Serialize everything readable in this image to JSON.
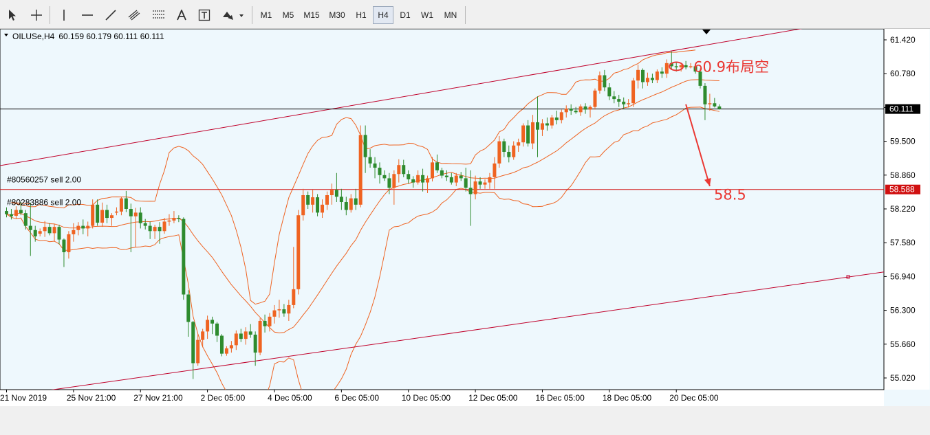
{
  "toolbar": {
    "tools": [
      {
        "name": "cursor-icon"
      },
      {
        "name": "crosshair-icon"
      },
      {
        "name": "vertical-line-icon"
      },
      {
        "name": "horizontal-line-icon"
      },
      {
        "name": "trendline-icon"
      },
      {
        "name": "equidistant-channel-icon"
      },
      {
        "name": "fibonacci-icon"
      },
      {
        "name": "text-icon"
      },
      {
        "name": "text-label-icon"
      },
      {
        "name": "arrows-icon"
      }
    ],
    "timeframes": [
      "M1",
      "M5",
      "M15",
      "M30",
      "H1",
      "H4",
      "D1",
      "W1",
      "MN"
    ],
    "active_timeframe": "H4"
  },
  "chart_header": {
    "symbol": "OILUSe,H4",
    "ohlc": "60.159 60.179 60.111 60.111"
  },
  "colors": {
    "background": "#eef8fd",
    "bull": "#ef6321",
    "bear": "#2e8b2e",
    "bands": "#ef6321",
    "channel": "#c0002a",
    "annotation": "#ea3833",
    "bid_line": "#000000",
    "order_line": "#d01010"
  },
  "chart_data": {
    "type": "candlestick",
    "y_axis_ticks": [
      61.42,
      60.78,
      60.14,
      59.5,
      58.86,
      58.22,
      57.58,
      56.94,
      56.3,
      55.66,
      55.02
    ],
    "y_axis_labels": [
      "61.420",
      "60.780",
      "60.140",
      "59.500",
      "58.860",
      "58.220",
      "57.580",
      "56.940",
      "56.300",
      "55.660",
      "55.020"
    ],
    "x_axis_labels": [
      "21 Nov 2019",
      "25 Nov 21:00",
      "27 Nov 21:00",
      "2 Dec 05:00",
      "4 Dec 05:00",
      "6 Dec 05:00",
      "10 Dec 05:00",
      "12 Dec 05:00",
      "16 Dec 05:00",
      "18 Dec 05:00",
      "20 Dec 05:00"
    ],
    "x_axis_label_bars": [
      0,
      14,
      28,
      42,
      56,
      70,
      84,
      98,
      112,
      126,
      140
    ],
    "current_price": 60.111,
    "current_price_label": "60.111",
    "order_line_price": 58.588,
    "order_line_label": "58.588",
    "orders": [
      "#80560257 sell 2.00",
      "#80283886 sell 2.00"
    ],
    "annotations": [
      {
        "text": "60.9布局空",
        "price": 60.92,
        "bar": 140
      },
      {
        "text": "58.5",
        "price": 58.5,
        "bar": 145
      }
    ],
    "projected_move": {
      "from_bar": 142,
      "from_price": 60.2,
      "to_bar": 147,
      "to_price": 58.65
    },
    "channel_upper": [
      {
        "bar": 0,
        "price": 59.06
      },
      {
        "bar": 157,
        "price": 61.49
      }
    ],
    "channel_lower": [
      {
        "bar": 20,
        "price": 54.93
      },
      {
        "bar": 186,
        "price": 57.06
      }
    ],
    "bars": [
      {
        "o": 58.18,
        "h": 58.25,
        "l": 58.06,
        "c": 58.12
      },
      {
        "o": 58.12,
        "h": 58.22,
        "l": 58.02,
        "c": 58.08
      },
      {
        "o": 58.09,
        "h": 58.27,
        "l": 58.03,
        "c": 58.2
      },
      {
        "o": 58.2,
        "h": 58.35,
        "l": 58.1,
        "c": 58.14
      },
      {
        "o": 58.14,
        "h": 58.2,
        "l": 57.83,
        "c": 57.9
      },
      {
        "o": 57.9,
        "h": 58.34,
        "l": 57.33,
        "c": 57.82
      },
      {
        "o": 57.82,
        "h": 57.9,
        "l": 57.6,
        "c": 57.7
      },
      {
        "o": 57.75,
        "h": 57.85,
        "l": 57.7,
        "c": 57.8
      },
      {
        "o": 57.8,
        "h": 57.99,
        "l": 57.69,
        "c": 57.88
      },
      {
        "o": 57.88,
        "h": 57.95,
        "l": 57.72,
        "c": 57.76
      },
      {
        "o": 57.76,
        "h": 57.93,
        "l": 57.6,
        "c": 57.88
      },
      {
        "o": 57.88,
        "h": 57.92,
        "l": 57.55,
        "c": 57.64
      },
      {
        "o": 57.64,
        "h": 57.66,
        "l": 57.12,
        "c": 57.4
      },
      {
        "o": 57.4,
        "h": 57.8,
        "l": 57.28,
        "c": 57.74
      },
      {
        "o": 57.74,
        "h": 57.95,
        "l": 57.6,
        "c": 57.82
      },
      {
        "o": 57.82,
        "h": 57.97,
        "l": 57.72,
        "c": 57.9
      },
      {
        "o": 57.9,
        "h": 58.02,
        "l": 57.74,
        "c": 57.85
      },
      {
        "o": 57.85,
        "h": 57.98,
        "l": 57.7,
        "c": 57.9
      },
      {
        "o": 57.9,
        "h": 58.4,
        "l": 57.85,
        "c": 58.3
      },
      {
        "o": 58.3,
        "h": 58.4,
        "l": 57.9,
        "c": 57.96
      },
      {
        "o": 57.96,
        "h": 58.34,
        "l": 57.88,
        "c": 58.2
      },
      {
        "o": 58.2,
        "h": 58.3,
        "l": 57.95,
        "c": 58.05
      },
      {
        "o": 58.05,
        "h": 58.14,
        "l": 57.9,
        "c": 58.1
      },
      {
        "o": 58.15,
        "h": 58.25,
        "l": 58.1,
        "c": 58.17
      },
      {
        "o": 58.17,
        "h": 58.45,
        "l": 58.1,
        "c": 58.42
      },
      {
        "o": 58.42,
        "h": 58.56,
        "l": 58.16,
        "c": 58.22
      },
      {
        "o": 58.22,
        "h": 58.32,
        "l": 57.4,
        "c": 58.08
      },
      {
        "o": 58.08,
        "h": 58.24,
        "l": 57.5,
        "c": 58.15
      },
      {
        "o": 58.15,
        "h": 58.25,
        "l": 57.85,
        "c": 57.95
      },
      {
        "o": 57.95,
        "h": 58.03,
        "l": 57.83,
        "c": 57.9
      },
      {
        "o": 57.9,
        "h": 57.98,
        "l": 57.65,
        "c": 57.8
      },
      {
        "o": 57.8,
        "h": 57.92,
        "l": 57.65,
        "c": 57.88
      },
      {
        "o": 57.88,
        "h": 57.97,
        "l": 57.56,
        "c": 57.8
      },
      {
        "o": 57.8,
        "h": 58.05,
        "l": 57.75,
        "c": 57.98
      },
      {
        "o": 57.98,
        "h": 58.12,
        "l": 57.9,
        "c": 58.0
      },
      {
        "o": 58.0,
        "h": 58.18,
        "l": 57.95,
        "c": 58.05
      },
      {
        "o": 58.05,
        "h": 58.1,
        "l": 57.97,
        "c": 58.03
      },
      {
        "o": 58.03,
        "h": 58.06,
        "l": 56.5,
        "c": 56.6
      },
      {
        "o": 56.6,
        "h": 56.68,
        "l": 55.8,
        "c": 56.08
      },
      {
        "o": 56.08,
        "h": 56.1,
        "l": 55.0,
        "c": 55.3
      },
      {
        "o": 55.3,
        "h": 55.85,
        "l": 55.25,
        "c": 55.74
      },
      {
        "o": 55.74,
        "h": 55.95,
        "l": 55.6,
        "c": 55.9
      },
      {
        "o": 55.9,
        "h": 56.2,
        "l": 55.76,
        "c": 56.12
      },
      {
        "o": 56.12,
        "h": 56.18,
        "l": 55.85,
        "c": 56.05
      },
      {
        "o": 56.05,
        "h": 56.08,
        "l": 55.7,
        "c": 55.82
      },
      {
        "o": 55.82,
        "h": 55.85,
        "l": 55.43,
        "c": 55.48
      },
      {
        "o": 55.48,
        "h": 55.62,
        "l": 55.44,
        "c": 55.58
      },
      {
        "o": 55.58,
        "h": 55.72,
        "l": 55.5,
        "c": 55.64
      },
      {
        "o": 55.64,
        "h": 55.92,
        "l": 55.55,
        "c": 55.86
      },
      {
        "o": 55.86,
        "h": 55.95,
        "l": 55.7,
        "c": 55.76
      },
      {
        "o": 55.76,
        "h": 55.98,
        "l": 55.65,
        "c": 55.9
      },
      {
        "o": 55.9,
        "h": 56.04,
        "l": 55.78,
        "c": 55.84
      },
      {
        "o": 55.84,
        "h": 55.9,
        "l": 55.25,
        "c": 55.5
      },
      {
        "o": 55.5,
        "h": 56.15,
        "l": 55.45,
        "c": 56.1
      },
      {
        "o": 56.1,
        "h": 56.22,
        "l": 55.88,
        "c": 56.0
      },
      {
        "o": 56.0,
        "h": 56.25,
        "l": 55.9,
        "c": 56.18
      },
      {
        "o": 56.18,
        "h": 56.4,
        "l": 56.05,
        "c": 56.3
      },
      {
        "o": 56.3,
        "h": 56.5,
        "l": 56.16,
        "c": 56.32
      },
      {
        "o": 56.32,
        "h": 56.42,
        "l": 56.18,
        "c": 56.24
      },
      {
        "o": 56.24,
        "h": 56.5,
        "l": 56.1,
        "c": 56.4
      },
      {
        "o": 56.4,
        "h": 57.5,
        "l": 56.34,
        "c": 56.7
      },
      {
        "o": 56.7,
        "h": 58.2,
        "l": 56.6,
        "c": 58.1
      },
      {
        "o": 58.1,
        "h": 58.6,
        "l": 58.0,
        "c": 58.48
      },
      {
        "o": 58.48,
        "h": 58.55,
        "l": 58.22,
        "c": 58.3
      },
      {
        "o": 58.3,
        "h": 58.58,
        "l": 58.15,
        "c": 58.44
      },
      {
        "o": 58.44,
        "h": 58.5,
        "l": 58.08,
        "c": 58.15
      },
      {
        "o": 58.15,
        "h": 58.4,
        "l": 58.05,
        "c": 58.3
      },
      {
        "o": 58.3,
        "h": 58.55,
        "l": 58.2,
        "c": 58.48
      },
      {
        "o": 58.48,
        "h": 58.7,
        "l": 58.3,
        "c": 58.58
      },
      {
        "o": 58.58,
        "h": 58.9,
        "l": 58.35,
        "c": 58.45
      },
      {
        "o": 58.45,
        "h": 58.6,
        "l": 58.2,
        "c": 58.35
      },
      {
        "o": 58.35,
        "h": 58.45,
        "l": 58.1,
        "c": 58.2
      },
      {
        "o": 58.2,
        "h": 58.5,
        "l": 58.15,
        "c": 58.42
      },
      {
        "o": 58.42,
        "h": 58.6,
        "l": 58.2,
        "c": 58.3
      },
      {
        "o": 58.3,
        "h": 59.8,
        "l": 58.25,
        "c": 59.62
      },
      {
        "o": 59.62,
        "h": 59.8,
        "l": 58.9,
        "c": 59.2
      },
      {
        "o": 59.2,
        "h": 59.35,
        "l": 59.0,
        "c": 59.08
      },
      {
        "o": 59.08,
        "h": 59.2,
        "l": 58.8,
        "c": 59.0
      },
      {
        "o": 59.0,
        "h": 59.1,
        "l": 58.7,
        "c": 58.86
      },
      {
        "o": 58.86,
        "h": 58.95,
        "l": 58.75,
        "c": 58.8
      },
      {
        "o": 58.8,
        "h": 58.9,
        "l": 58.5,
        "c": 58.62
      },
      {
        "o": 58.62,
        "h": 58.95,
        "l": 58.3,
        "c": 58.88
      },
      {
        "o": 58.88,
        "h": 59.16,
        "l": 58.72,
        "c": 59.05
      },
      {
        "o": 59.05,
        "h": 59.15,
        "l": 58.82,
        "c": 58.88
      },
      {
        "o": 58.88,
        "h": 58.95,
        "l": 58.7,
        "c": 58.78
      },
      {
        "o": 58.78,
        "h": 58.84,
        "l": 58.62,
        "c": 58.72
      },
      {
        "o": 58.72,
        "h": 58.95,
        "l": 58.68,
        "c": 58.86
      },
      {
        "o": 58.86,
        "h": 58.98,
        "l": 58.55,
        "c": 58.72
      },
      {
        "o": 58.72,
        "h": 58.85,
        "l": 58.52,
        "c": 58.8
      },
      {
        "o": 58.8,
        "h": 59.2,
        "l": 58.74,
        "c": 59.1
      },
      {
        "o": 59.1,
        "h": 59.25,
        "l": 58.9,
        "c": 58.95
      },
      {
        "o": 58.95,
        "h": 59.0,
        "l": 58.8,
        "c": 58.85
      },
      {
        "o": 58.85,
        "h": 58.95,
        "l": 58.75,
        "c": 58.82
      },
      {
        "o": 58.82,
        "h": 58.9,
        "l": 58.68,
        "c": 58.72
      },
      {
        "o": 58.72,
        "h": 58.9,
        "l": 58.65,
        "c": 58.85
      },
      {
        "o": 58.85,
        "h": 58.92,
        "l": 58.75,
        "c": 58.8
      },
      {
        "o": 58.8,
        "h": 59.0,
        "l": 58.55,
        "c": 58.62
      },
      {
        "o": 58.62,
        "h": 58.95,
        "l": 57.9,
        "c": 58.5
      },
      {
        "o": 58.5,
        "h": 58.85,
        "l": 58.4,
        "c": 58.74
      },
      {
        "o": 58.74,
        "h": 58.82,
        "l": 58.6,
        "c": 58.68
      },
      {
        "o": 58.68,
        "h": 58.78,
        "l": 58.6,
        "c": 58.72
      },
      {
        "o": 58.72,
        "h": 58.9,
        "l": 58.6,
        "c": 58.82
      },
      {
        "o": 58.82,
        "h": 59.2,
        "l": 58.6,
        "c": 59.08
      },
      {
        "o": 59.08,
        "h": 59.6,
        "l": 59.0,
        "c": 59.5
      },
      {
        "o": 59.5,
        "h": 59.55,
        "l": 59.2,
        "c": 59.3
      },
      {
        "o": 59.3,
        "h": 59.42,
        "l": 59.1,
        "c": 59.2
      },
      {
        "o": 59.2,
        "h": 59.5,
        "l": 59.15,
        "c": 59.42
      },
      {
        "o": 59.42,
        "h": 59.55,
        "l": 59.3,
        "c": 59.48
      },
      {
        "o": 59.48,
        "h": 59.84,
        "l": 59.4,
        "c": 59.8
      },
      {
        "o": 59.8,
        "h": 59.9,
        "l": 59.4,
        "c": 59.46
      },
      {
        "o": 59.46,
        "h": 60.0,
        "l": 59.35,
        "c": 59.86
      },
      {
        "o": 59.86,
        "h": 60.35,
        "l": 59.2,
        "c": 59.72
      },
      {
        "o": 59.72,
        "h": 59.92,
        "l": 59.6,
        "c": 59.84
      },
      {
        "o": 59.84,
        "h": 59.95,
        "l": 59.7,
        "c": 59.8
      },
      {
        "o": 59.8,
        "h": 60.0,
        "l": 59.74,
        "c": 59.95
      },
      {
        "o": 59.95,
        "h": 60.08,
        "l": 59.82,
        "c": 59.9
      },
      {
        "o": 59.9,
        "h": 60.1,
        "l": 59.84,
        "c": 60.05
      },
      {
        "o": 60.05,
        "h": 60.18,
        "l": 59.95,
        "c": 60.12
      },
      {
        "o": 60.12,
        "h": 60.2,
        "l": 60.0,
        "c": 60.08
      },
      {
        "o": 60.08,
        "h": 60.15,
        "l": 60.02,
        "c": 60.05
      },
      {
        "o": 60.05,
        "h": 60.2,
        "l": 59.98,
        "c": 60.16
      },
      {
        "o": 60.16,
        "h": 60.22,
        "l": 60.02,
        "c": 60.1
      },
      {
        "o": 60.1,
        "h": 60.18,
        "l": 59.95,
        "c": 60.15
      },
      {
        "o": 60.15,
        "h": 60.5,
        "l": 60.1,
        "c": 60.46
      },
      {
        "o": 60.46,
        "h": 60.82,
        "l": 60.4,
        "c": 60.75
      },
      {
        "o": 60.75,
        "h": 60.85,
        "l": 60.45,
        "c": 60.52
      },
      {
        "o": 60.52,
        "h": 60.6,
        "l": 60.28,
        "c": 60.35
      },
      {
        "o": 60.35,
        "h": 60.45,
        "l": 60.22,
        "c": 60.3
      },
      {
        "o": 60.3,
        "h": 60.38,
        "l": 60.15,
        "c": 60.25
      },
      {
        "o": 60.25,
        "h": 60.33,
        "l": 60.12,
        "c": 60.2
      },
      {
        "o": 60.2,
        "h": 60.3,
        "l": 60.14,
        "c": 60.22
      },
      {
        "o": 60.22,
        "h": 60.7,
        "l": 60.15,
        "c": 60.65
      },
      {
        "o": 60.65,
        "h": 60.95,
        "l": 60.5,
        "c": 60.85
      },
      {
        "o": 60.85,
        "h": 60.88,
        "l": 60.5,
        "c": 60.62
      },
      {
        "o": 60.62,
        "h": 60.8,
        "l": 60.55,
        "c": 60.7
      },
      {
        "o": 60.7,
        "h": 60.78,
        "l": 60.6,
        "c": 60.66
      },
      {
        "o": 60.66,
        "h": 60.86,
        "l": 60.6,
        "c": 60.82
      },
      {
        "o": 60.82,
        "h": 60.9,
        "l": 60.7,
        "c": 60.78
      },
      {
        "o": 60.78,
        "h": 61.05,
        "l": 60.7,
        "c": 60.98
      },
      {
        "o": 60.98,
        "h": 61.2,
        "l": 60.85,
        "c": 60.92
      },
      {
        "o": 60.92,
        "h": 61.0,
        "l": 60.82,
        "c": 60.9
      },
      {
        "o": 60.9,
        "h": 60.96,
        "l": 60.82,
        "c": 60.94
      },
      {
        "o": 60.94,
        "h": 61.02,
        "l": 60.86,
        "c": 60.9
      },
      {
        "o": 60.9,
        "h": 60.98,
        "l": 60.88,
        "c": 60.92
      },
      {
        "o": 60.92,
        "h": 60.96,
        "l": 60.78,
        "c": 60.82
      },
      {
        "o": 60.82,
        "h": 60.88,
        "l": 60.5,
        "c": 60.55
      },
      {
        "o": 60.55,
        "h": 60.6,
        "l": 59.9,
        "c": 60.2
      },
      {
        "o": 60.2,
        "h": 60.4,
        "l": 60.08,
        "c": 60.22
      },
      {
        "o": 60.22,
        "h": 60.32,
        "l": 60.14,
        "c": 60.16
      },
      {
        "o": 60.16,
        "h": 60.2,
        "l": 60.1,
        "c": 60.11
      }
    ]
  }
}
